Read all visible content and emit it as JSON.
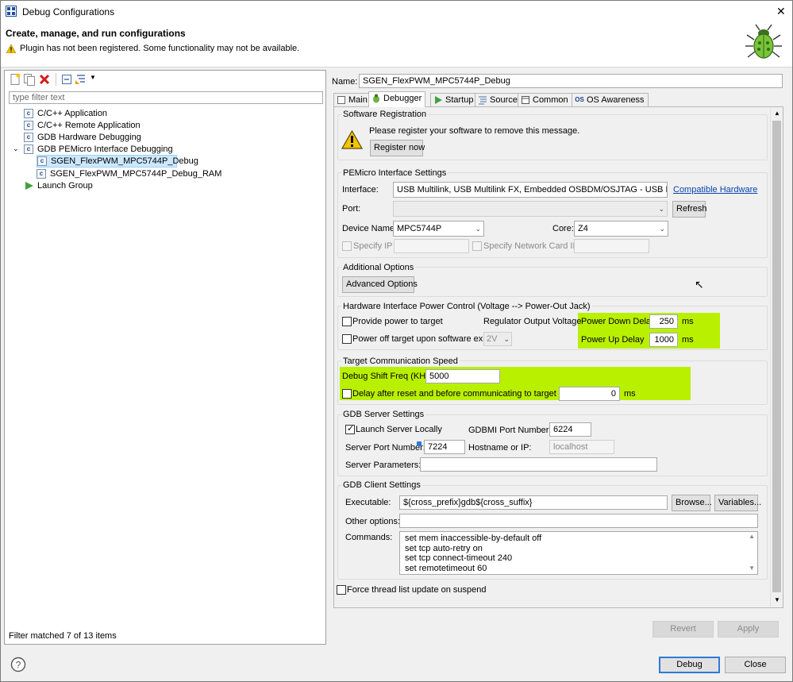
{
  "window": {
    "title": "Debug Configurations",
    "close_glyph": "✕"
  },
  "banner": {
    "heading": "Create, manage, and run configurations",
    "warning": "Plugin has not been registered. Some functionality may not be available."
  },
  "left": {
    "filter_placeholder": "type filter text",
    "tree": [
      {
        "label": "C/C++ Application"
      },
      {
        "label": "C/C++ Remote Application"
      },
      {
        "label": "GDB Hardware Debugging"
      },
      {
        "label": "GDB PEMicro Interface Debugging"
      },
      {
        "label": "SGEN_FlexPWM_MPC5744P_Debug"
      },
      {
        "label": "SGEN_FlexPWM_MPC5744P_Debug_RAM"
      },
      {
        "label": "Launch Group"
      }
    ],
    "status": "Filter matched 7 of 13 items"
  },
  "config": {
    "name_label": "Name:",
    "name_value": "SGEN_FlexPWM_MPC5744P_Debug",
    "tabs": [
      "Main",
      "Debugger",
      "Startup",
      "Source",
      "Common",
      "OS Awareness"
    ]
  },
  "registration": {
    "title": "Software Registration",
    "message": "Please register your software to remove this message.",
    "button": "Register now"
  },
  "pemicro": {
    "title": "PEMicro Interface Settings",
    "interface_label": "Interface:",
    "interface_value": "USB Multilink, USB Multilink FX, Embedded OSBDM/OSJTAG - USB Port",
    "compatible_link": "Compatible Hardware",
    "port_label": "Port:",
    "port_value": "",
    "refresh": "Refresh",
    "device_label": "Device Name:",
    "device_value": "MPC5744P",
    "core_label": "Core:",
    "core_value": "Z4",
    "specify_ip": "Specify IP",
    "specify_nic": "Specify Network Card IP"
  },
  "additional": {
    "title": "Additional Options",
    "button": "Advanced Options"
  },
  "power": {
    "title": "Hardware Interface Power Control (Voltage --> Power-Out Jack)",
    "provide_power": "Provide power to target",
    "regulator_label": "Regulator Output Voltage",
    "power_off": "Power off target upon software exit",
    "voltage_value": "2V",
    "down_label": "Power Down Delay",
    "down_value": "250",
    "up_label": "Power Up Delay",
    "up_value": "1000",
    "unit": "ms"
  },
  "speed": {
    "title": "Target Communication Speed",
    "freq_label": "Debug Shift Freq (KHz)",
    "freq_value": "5000",
    "delay_label": "Delay after reset and before communicating to target for",
    "delay_value": "0",
    "unit": "ms"
  },
  "server": {
    "title": "GDB Server Settings",
    "launch_locally": "Launch Server Locally",
    "gdbmi_label": "GDBMI Port Number:",
    "gdbmi_value": "6224",
    "server_port_label": "Server Port Number:",
    "server_port_value": "7224",
    "hostname_label": "Hostname or IP:",
    "hostname_value": "localhost",
    "params_label": "Server Parameters:",
    "params_value": ""
  },
  "client": {
    "title": "GDB Client Settings",
    "exec_label": "Executable:",
    "exec_value": "${cross_prefix}gdb${cross_suffix}",
    "browse": "Browse...",
    "variables": "Variables...",
    "other_label": "Other options:",
    "other_value": "",
    "commands_label": "Commands:",
    "commands": [
      "set mem inaccessible-by-default off",
      "set tcp auto-retry on",
      "set tcp connect-timeout 240",
      "set remotetimeout 60"
    ]
  },
  "force_thread": "Force thread list update on suspend",
  "buttons": {
    "revert": "Revert",
    "apply": "Apply",
    "debug": "Debug",
    "close": "Close"
  },
  "colors": {
    "highlight": "#b9f000",
    "link": "#0645ad",
    "default_button": "#2f7ad6"
  }
}
